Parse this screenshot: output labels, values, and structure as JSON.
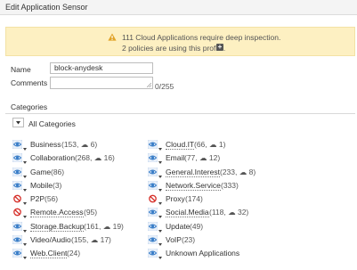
{
  "window": {
    "title": "Edit Application Sensor"
  },
  "banner": {
    "line1": "111 Cloud Applications require deep inspection.",
    "line2": "2 policies are using this profile.",
    "plus_icon": "+",
    "warning_color": "#e1a326"
  },
  "form": {
    "name_label": "Name",
    "name_value": "block-anydesk",
    "comments_label": "Comments",
    "comments_value": "",
    "comments_counter": "0/255"
  },
  "categories": {
    "heading": "Categories",
    "all_label": "All Categories",
    "left": [
      {
        "icon": "eye-icon",
        "name": "Business",
        "stats": " (153, ☁ 6)"
      },
      {
        "icon": "eye-icon",
        "name": "Collaboration",
        "stats": " (268, ☁ 16)"
      },
      {
        "icon": "eye-icon",
        "name": "Game",
        "stats": " (86)"
      },
      {
        "icon": "eye-icon",
        "name": "Mobile",
        "stats": " (3)"
      },
      {
        "icon": "block-icon",
        "name": "P2P",
        "stats": " (56)"
      },
      {
        "icon": "block-icon",
        "name": "Remote.Access",
        "stats": " (95)"
      },
      {
        "icon": "eye-icon",
        "name": "Storage.Backup",
        "stats": " (161, ☁ 19)"
      },
      {
        "icon": "eye-icon",
        "name": "Video/Audio",
        "stats": " (155, ☁ 17)"
      },
      {
        "icon": "eye-icon",
        "name": "Web.Client",
        "stats": " (24)"
      }
    ],
    "right": [
      {
        "icon": "eye-icon",
        "name": "Cloud.IT",
        "stats": " (66, ☁ 1)"
      },
      {
        "icon": "eye-icon",
        "name": "Email",
        "stats": " (77, ☁ 12)"
      },
      {
        "icon": "eye-icon",
        "name": "General.Interest",
        "stats": " (233, ☁ 8)"
      },
      {
        "icon": "eye-icon",
        "name": "Network.Service",
        "stats": " (333)"
      },
      {
        "icon": "block-icon",
        "name": "Proxy",
        "stats": " (174)"
      },
      {
        "icon": "eye-icon",
        "name": "Social.Media",
        "stats": " (118, ☁ 32)"
      },
      {
        "icon": "eye-icon",
        "name": "Update",
        "stats": " (49)"
      },
      {
        "icon": "eye-icon",
        "name": "VoIP",
        "stats": " (23)"
      },
      {
        "icon": "eye-icon",
        "name": "Unknown Applications",
        "stats": ""
      }
    ],
    "colors": {
      "eye": "#3a7ec8",
      "block": "#d6312b"
    }
  }
}
